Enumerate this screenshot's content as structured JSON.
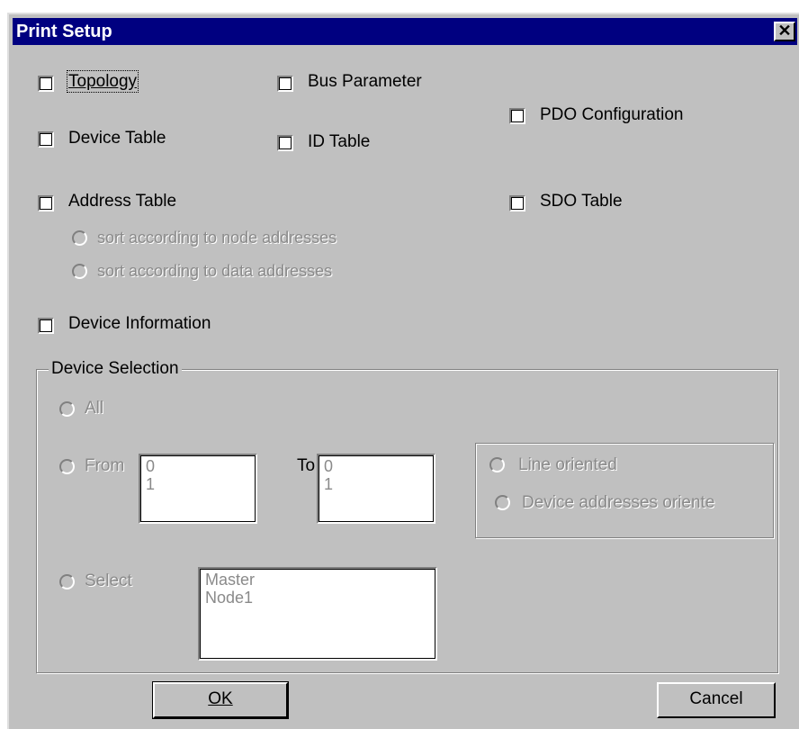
{
  "dialog": {
    "title": "Print Setup",
    "close_glyph": "✕"
  },
  "options": {
    "topology": "Topology",
    "bus_parameter": "Bus Parameter",
    "pdo_configuration": "PDO Configuration",
    "device_table": "Device Table",
    "id_table": "ID Table",
    "address_table": "Address Table",
    "sdo_table": "SDO Table",
    "sort_node": "sort according to node addresses",
    "sort_data": "sort according to data addresses",
    "device_information": "Device Information"
  },
  "device_selection": {
    "label": "Device Selection",
    "all": "All",
    "from": "From",
    "to": "To",
    "from_list": [
      "0",
      "1"
    ],
    "to_list": [
      "0",
      "1"
    ],
    "line_oriented": "Line oriented",
    "device_addresses": "Device addresses oriente",
    "select": "Select",
    "select_list": [
      "Master",
      "Node1"
    ]
  },
  "buttons": {
    "ok": "OK",
    "cancel": "Cancel"
  },
  "colors": {
    "titlebar": "#000080",
    "face": "#c0c0c0",
    "disabled_text": "#8a8a8a"
  }
}
